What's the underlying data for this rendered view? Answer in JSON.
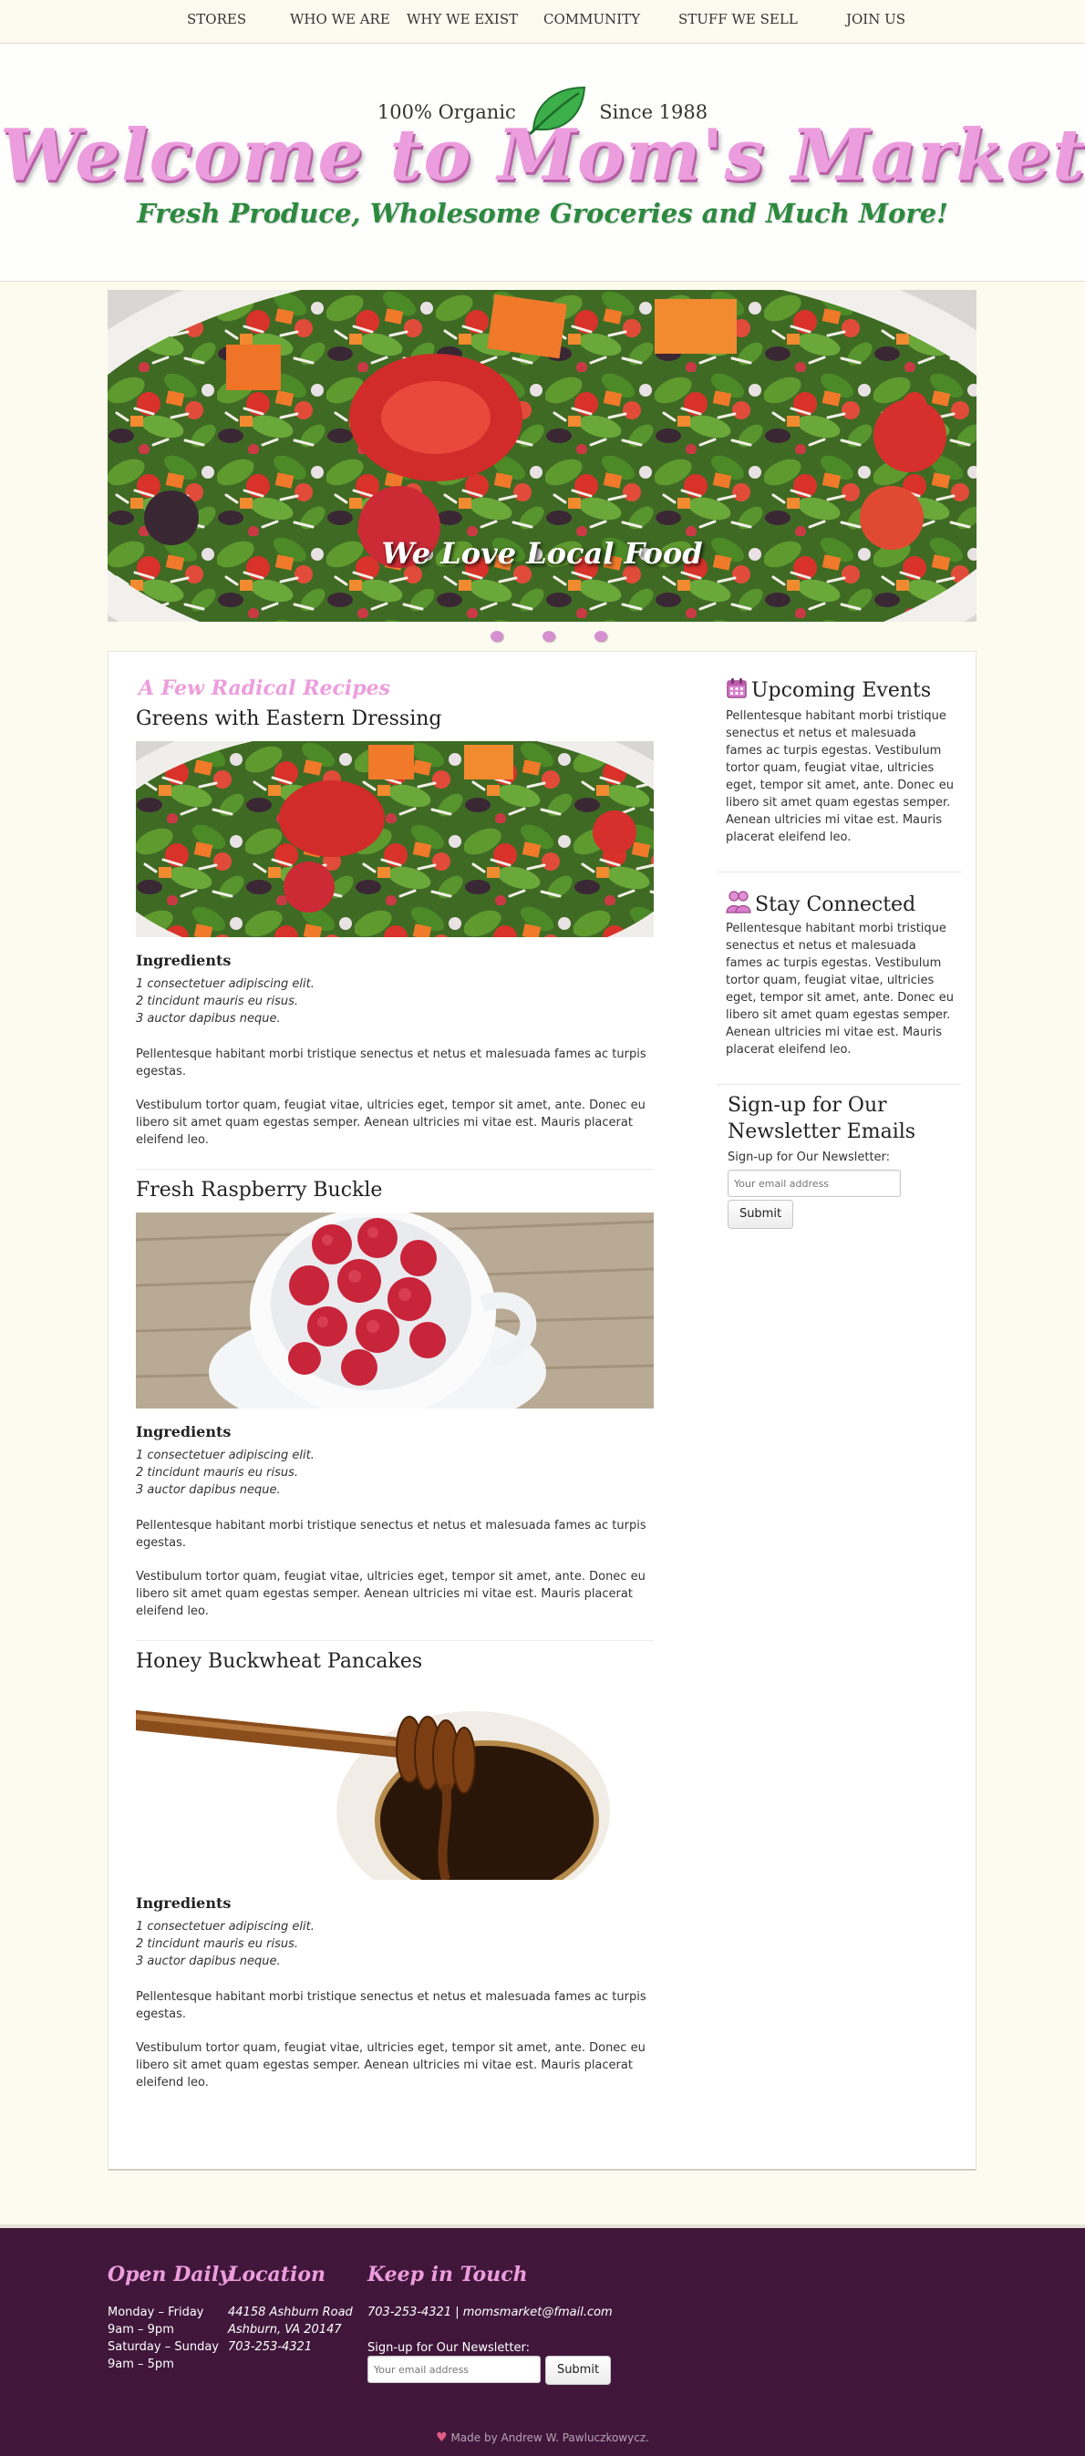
{
  "nav": {
    "items": [
      {
        "label": "STORES"
      },
      {
        "label": "WHO WE ARE"
      },
      {
        "label": "WHY WE EXIST"
      },
      {
        "label": "COMMUNITY"
      },
      {
        "label": "STUFF WE SELL"
      },
      {
        "label": "JOIN US"
      }
    ]
  },
  "header": {
    "tag_left": "100% Organic",
    "tag_right": "Since 1988",
    "title": "Welcome to Mom's Market",
    "subtitle": "Fresh Produce, Wholesome Groceries and Much More!"
  },
  "hero": {
    "caption": "We Love Local Food",
    "slides": 3
  },
  "main": {
    "section_title": "A Few Radical Recipes",
    "recipes": [
      {
        "title": "Greens with Eastern Dressing",
        "ingredients_heading": "Ingredients",
        "ingredients": [
          "1 consectetuer adipiscing elit.",
          "2 tincidunt mauris eu risus.",
          "3 auctor dapibus neque."
        ],
        "para1": "Pellentesque habitant morbi tristique senectus et netus et malesuada fames ac turpis egestas.",
        "para2": "Vestibulum tortor quam, feugiat vitae, ultricies eget, tempor sit amet, ante. Donec eu libero sit amet quam egestas semper. Aenean ultricies mi vitae est. Mauris placerat eleifend leo."
      },
      {
        "title": "Fresh Raspberry Buckle",
        "ingredients_heading": "Ingredients",
        "ingredients": [
          "1 consectetuer adipiscing elit.",
          "2 tincidunt mauris eu risus.",
          "3 auctor dapibus neque."
        ],
        "para1": "Pellentesque habitant morbi tristique senectus et netus et malesuada fames ac turpis egestas.",
        "para2": "Vestibulum tortor quam, feugiat vitae, ultricies eget, tempor sit amet, ante. Donec eu libero sit amet quam egestas semper. Aenean ultricies mi vitae est. Mauris placerat eleifend leo."
      },
      {
        "title": "Honey Buckwheat Pancakes",
        "ingredients_heading": "Ingredients",
        "ingredients": [
          "1 consectetuer adipiscing elit.",
          "2 tincidunt mauris eu risus.",
          "3 auctor dapibus neque."
        ],
        "para1": "Pellentesque habitant morbi tristique senectus et netus et malesuada fames ac turpis egestas.",
        "para2": "Vestibulum tortor quam, feugiat vitae, ultricies eget, tempor sit amet, ante. Donec eu libero sit amet quam egestas semper. Aenean ultricies mi vitae est. Mauris placerat eleifend leo."
      }
    ]
  },
  "sidebar": {
    "events_title": "Upcoming Events",
    "events_text": "Pellentesque habitant morbi tristique senectus et netus et malesuada fames ac turpis egestas. Vestibulum tortor quam, feugiat vitae, ultricies eget, tempor sit amet, ante. Donec eu libero sit amet quam egestas semper. Aenean ultricies mi vitae est. Mauris placerat eleifend leo.",
    "connect_title": "Stay Connected",
    "connect_text": "Pellentesque habitant morbi tristique senectus et netus et malesuada fames ac turpis egestas. Vestibulum tortor quam, feugiat vitae, ultricies eget, tempor sit amet, ante. Donec eu libero sit amet quam egestas semper. Aenean ultricies mi vitae est. Mauris placerat eleifend leo.",
    "newsletter_title": "Sign-up for Our Newsletter Emails",
    "newsletter_label": "Sign-up for Our Newsletter:",
    "email_placeholder": "Your email address",
    "submit_label": "Submit"
  },
  "footer": {
    "hours_title": "Open Daily",
    "hours": [
      "Monday – Friday",
      "9am – 9pm",
      "Saturday – Sunday",
      "9am – 5pm"
    ],
    "location_title": "Location",
    "location": [
      "44158 Ashburn Road",
      "Ashburn, VA 20147",
      "703-253-4321"
    ],
    "contact_title": "Keep in Touch",
    "contact_line": "703-253-4321 | momsmarket@fmail.com",
    "newsletter_label": "Sign-up for Our Newsletter:",
    "email_placeholder": "Your email address",
    "submit_label": "Submit",
    "credit": "Made by Andrew W. Pawluczkowycz."
  },
  "colors": {
    "background": "#fdfbef",
    "pink": "#ec9ddd",
    "green": "#2c8a3f",
    "footer": "#40173b"
  },
  "icons": [
    "leaf-icon",
    "calendar-icon",
    "people-icon",
    "heart-icon"
  ]
}
